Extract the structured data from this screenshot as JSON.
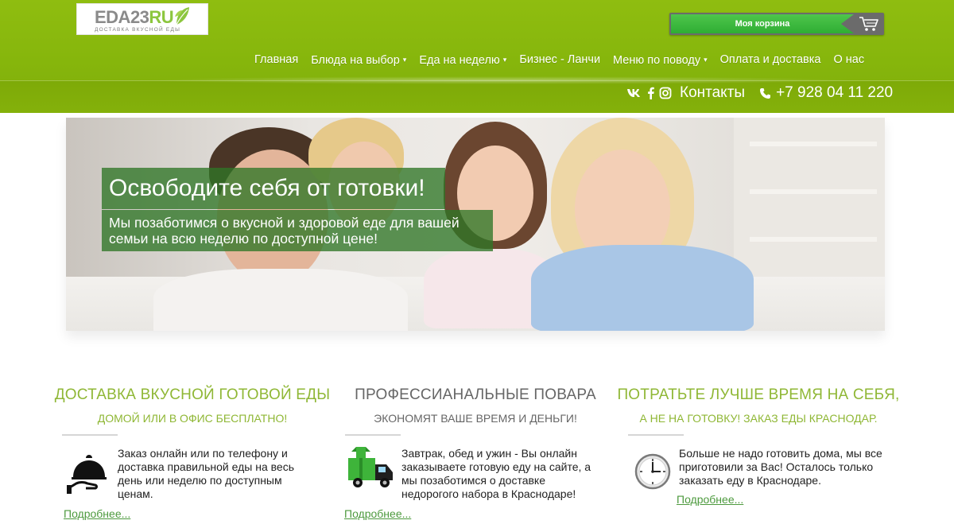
{
  "logo": {
    "word": "EDA23",
    "word_accent": "RU",
    "tagline": "ДОСТАВКА ВКУСНОЙ ЕДЫ"
  },
  "cart": {
    "label": "Моя корзина",
    "icon": "shopping-cart-icon"
  },
  "nav": {
    "items": [
      {
        "label": "Главная",
        "has_dropdown": false
      },
      {
        "label": "Блюда на выбор",
        "has_dropdown": true
      },
      {
        "label": "Еда на неделю",
        "has_dropdown": true
      },
      {
        "label": "Бизнес - Ланчи",
        "has_dropdown": false
      },
      {
        "label": "Меню по поводу",
        "has_dropdown": true
      },
      {
        "label": "Оплата и доставка",
        "has_dropdown": false
      },
      {
        "label": "О нас",
        "has_dropdown": false
      }
    ],
    "caret": "▾"
  },
  "contacts": {
    "social": [
      "vk",
      "f",
      "instagram"
    ],
    "link_label": "Контакты",
    "phone": "+7 928 04 11 220"
  },
  "hero": {
    "title": "Освободите себя от готовки!",
    "subtitle": "Мы позаботимся о вкусной и здоровой еде для вашей семьи на всю неделю по доступной цене!"
  },
  "features": [
    {
      "title": "ДОСТАВКА ВКУСНОЙ ГОТОВОЙ ЕДЫ",
      "subtitle": "ДОМОЙ ИЛИ В ОФИС БЕСПЛАТНО!",
      "text": "Заказ онлайн или по телефону и доставка правильной еды на весь день или неделю по доступным ценам.",
      "more": "Подробнее...",
      "icon": "food-cloche-icon"
    },
    {
      "title": "ПРОФЕССИАНАЛЬНЫЕ ПОВАРА",
      "subtitle": "ЭКОНОМЯТ ВАШЕ ВРЕМЯ И ДЕНЬГИ!",
      "text": "Завтрак, обед и ужин - Вы онлайн заказываете готовую еду на сайте, а мы позаботимся о доставке недорогого набора в Краснодаре!",
      "more": "Подробнее...",
      "icon": "delivery-truck-icon"
    },
    {
      "title": "ПОТРАТЬТЕ ЛУЧШЕ ВРЕМЯ НА СЕБЯ,",
      "subtitle": "А НЕ НА ГОТОВКУ!  ЗАКАЗ ЕДЫ КРАСНОДАР.",
      "text": "Больше не надо готовить дома, мы все приготовили за Вас! Осталось только заказать еду в Краснодаре.",
      "more": "Подробнее...",
      "icon": "clock-icon"
    }
  ],
  "colors": {
    "header_green": "#86b60c",
    "accent_green": "#8fb735",
    "cart_green": "#3cb83e",
    "hero_overlay": "#307626"
  }
}
